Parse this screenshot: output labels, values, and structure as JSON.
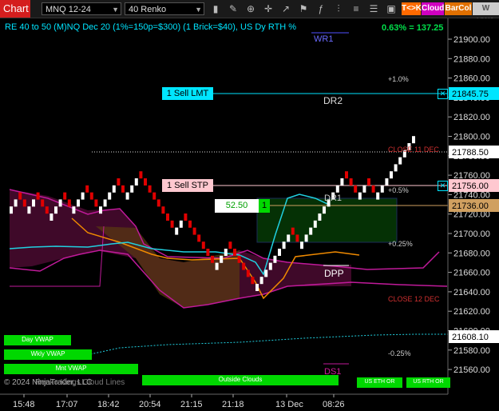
{
  "toolbar": {
    "chart_label": "Chart",
    "instrument": "MNQ 12-24",
    "bar_type": "40 Renko",
    "btn_tk": "T<>K",
    "btn_cloud": "Cloud",
    "btn_barcol": "BarCol",
    "btn_vwap": "W VWA"
  },
  "chart": {
    "title": "RE 40 to 50 (M)NQ Dec 20 (1%=150p=$300) (1 Brick=$40), US Dy RTH %",
    "change_readout": "0.63% = 137.25",
    "copyright": "© 2024 NinjaTrader, LLC",
    "brand_overlay": "Renko Kings Cloud Lines",
    "colors": {
      "accent": "#00e5ff",
      "up": "#ffffff",
      "down": "#e00000",
      "cloud": "#c01a9a",
      "signal": "#00d800"
    }
  },
  "price_axis": {
    "labels": [
      "21900.00",
      "21880.00",
      "21860.00",
      "21840.00",
      "21820.00",
      "21800.00",
      "21780.00",
      "21760.00",
      "21740.00",
      "21720.00",
      "21700.00",
      "21680.00",
      "21660.00",
      "21640.00",
      "21620.00",
      "21600.00",
      "21580.00",
      "21560.00"
    ],
    "flags": {
      "lmt": "21845.75",
      "last": "21788.50",
      "stp": "21756.00",
      "pos": "21736.00",
      "vwap": "21608.10"
    }
  },
  "time_axis": {
    "labels": [
      "15:48",
      "17:07",
      "18:42",
      "20:54",
      "21:15",
      "21:18",
      "13 Dec",
      "08:26"
    ]
  },
  "orders": {
    "sell_lmt": "1 Sell LMT",
    "sell_stp": "1 Sell STP",
    "pos_pl": "52.50",
    "pos_qty": "1"
  },
  "levels": {
    "wr1": "WR1",
    "dr2": "DR2",
    "dr1": "DR1",
    "dpp": "DPP",
    "ds1": "DS1",
    "pct_p1": "+1.0%",
    "pct_p05": "+0.5%",
    "pct_p025": "+0.25%",
    "pct_m025": "-0.25%",
    "close_11": "CLOSE 11 DEC",
    "close_12": "CLOSE 12 DEC"
  },
  "panels": {
    "day_vwap": "Day VWAP",
    "wkly_vwap": "Wkly VWAP",
    "mnt_vwap": "Mnt VWAP",
    "outside_clouds": "Outside Clouds",
    "us_eth_or": "US ETH OR",
    "us_rth_or": "US RTH OR"
  }
}
